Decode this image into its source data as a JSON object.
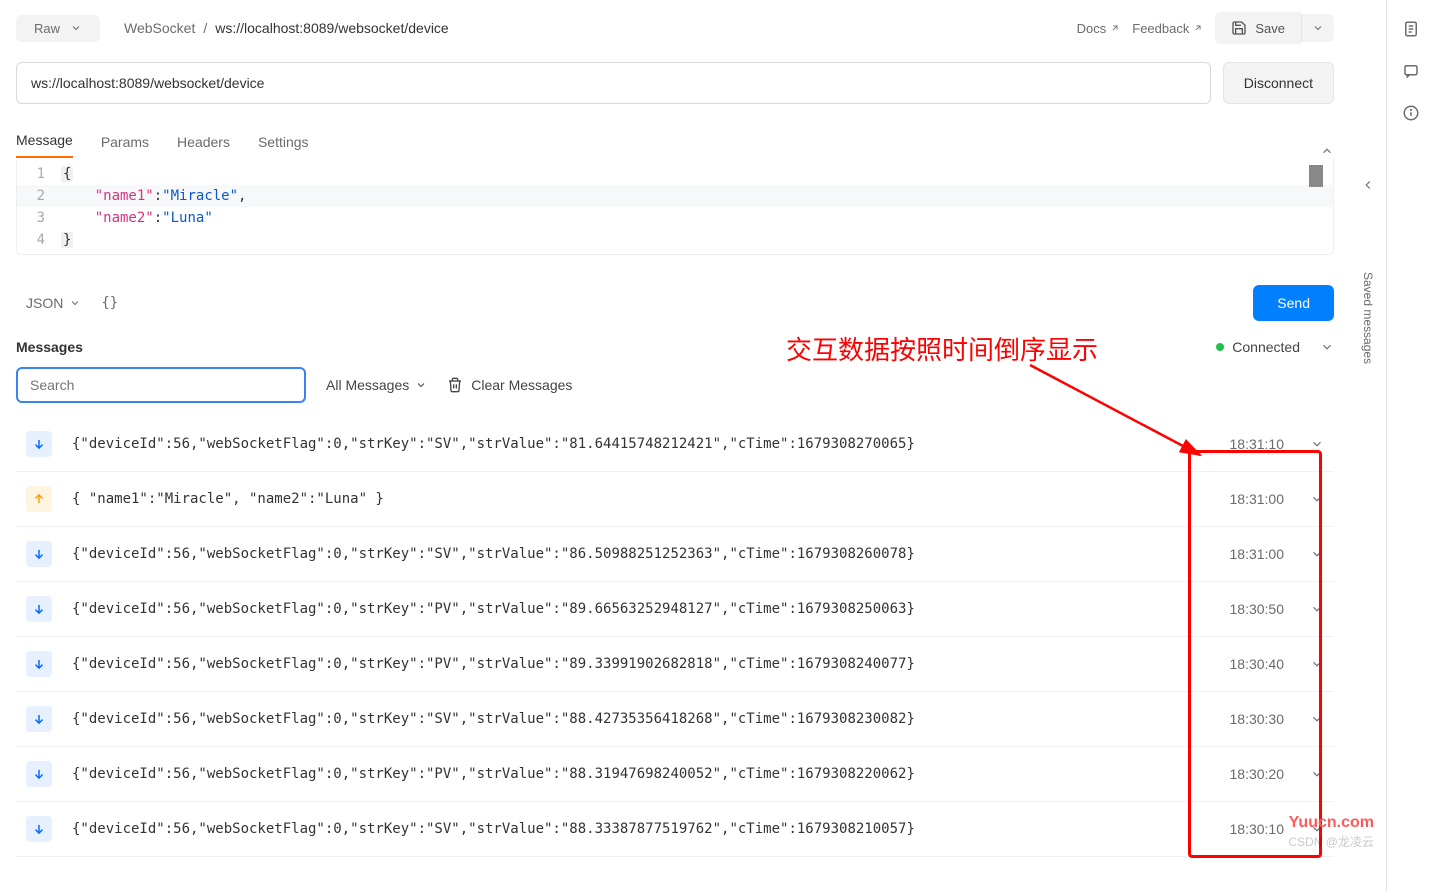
{
  "header": {
    "raw_label": "Raw",
    "crumb_protocol": "WebSocket",
    "crumb_separator": "/",
    "crumb_url": "ws://localhost:8089/websocket/device",
    "docs_label": "Docs",
    "feedback_label": "Feedback",
    "save_label": "Save"
  },
  "url_bar": {
    "value": "ws://localhost:8089/websocket/device",
    "disconnect_label": "Disconnect"
  },
  "tabs": {
    "message": "Message",
    "params": "Params",
    "headers": "Headers",
    "settings": "Settings"
  },
  "editor": {
    "line1": "{",
    "line2_key": "\"name1\"",
    "line2_val": "\"Miracle\"",
    "line3_key": "\"name2\"",
    "line3_val": "\"Luna\"",
    "line4": "}"
  },
  "format_bar": {
    "json_label": "JSON",
    "beautify_glyph": "{}",
    "send_label": "Send"
  },
  "messages_panel": {
    "title": "Messages",
    "status_label": "Connected",
    "search_placeholder": "Search",
    "filter_label": "All Messages",
    "clear_label": "Clear Messages"
  },
  "messages": [
    {
      "dir": "down",
      "content": "{\"deviceId\":56,\"webSocketFlag\":0,\"strKey\":\"SV\",\"strValue\":\"81.64415748212421\",\"cTime\":1679308270065}",
      "time": "18:31:10"
    },
    {
      "dir": "up",
      "content": "{ \"name1\":\"Miracle\", \"name2\":\"Luna\" }",
      "time": "18:31:00"
    },
    {
      "dir": "down",
      "content": "{\"deviceId\":56,\"webSocketFlag\":0,\"strKey\":\"SV\",\"strValue\":\"86.50988251252363\",\"cTime\":1679308260078}",
      "time": "18:31:00"
    },
    {
      "dir": "down",
      "content": "{\"deviceId\":56,\"webSocketFlag\":0,\"strKey\":\"PV\",\"strValue\":\"89.66563252948127\",\"cTime\":1679308250063}",
      "time": "18:30:50"
    },
    {
      "dir": "down",
      "content": "{\"deviceId\":56,\"webSocketFlag\":0,\"strKey\":\"PV\",\"strValue\":\"89.33991902682818\",\"cTime\":1679308240077}",
      "time": "18:30:40"
    },
    {
      "dir": "down",
      "content": "{\"deviceId\":56,\"webSocketFlag\":0,\"strKey\":\"SV\",\"strValue\":\"88.42735356418268\",\"cTime\":1679308230082}",
      "time": "18:30:30"
    },
    {
      "dir": "down",
      "content": "{\"deviceId\":56,\"webSocketFlag\":0,\"strKey\":\"PV\",\"strValue\":\"88.31947698240052\",\"cTime\":1679308220062}",
      "time": "18:30:20"
    },
    {
      "dir": "down",
      "content": "{\"deviceId\":56,\"webSocketFlag\":0,\"strKey\":\"SV\",\"strValue\":\"88.33387877519762\",\"cTime\":1679308210057}",
      "time": "18:30:10"
    }
  ],
  "annotation": {
    "text": "交互数据按照时间倒序显示"
  },
  "watermark": {
    "site": "Yuucn.com",
    "author": "CSDN @龙凌云"
  },
  "rail": {
    "label": "Saved messages"
  }
}
